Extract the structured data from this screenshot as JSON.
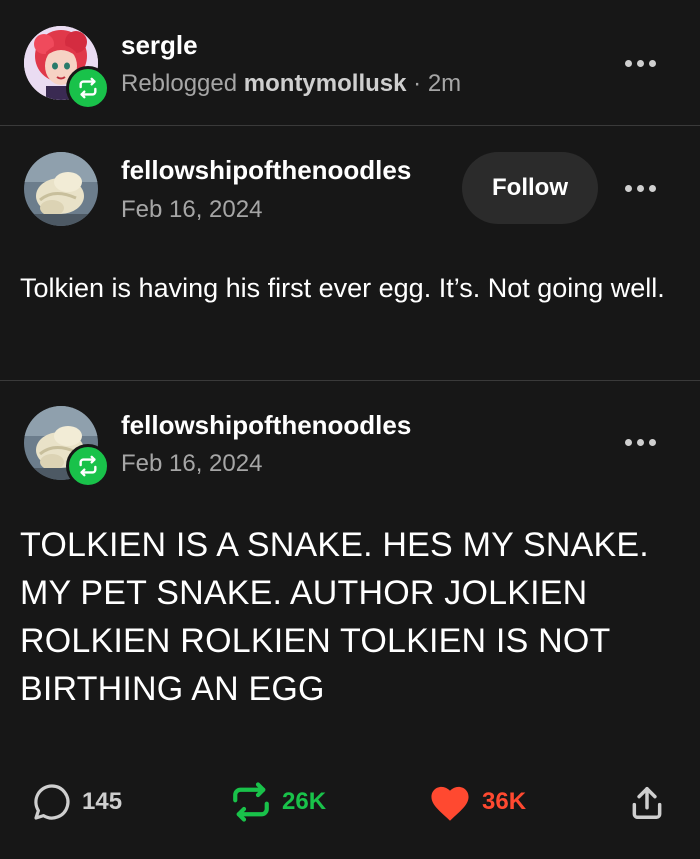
{
  "reblog_header": {
    "username": "sergle",
    "reblogged_prefix": "Reblogged",
    "reblogged_from": "montymollusk",
    "time": "· 2m",
    "avatar_icon": "anime-avatar-red-hair",
    "badge_icon": "reblog-icon",
    "more_icon": "more-options-icon"
  },
  "post1": {
    "username": "fellowshipofthenoodles",
    "date": "Feb 16, 2024",
    "follow_label": "Follow",
    "text": "Tolkien is having his first ever egg. It’s. Not going well.",
    "avatar_icon": "snake-avatar"
  },
  "post2": {
    "username": "fellowshipofthenoodles",
    "date": "Feb 16, 2024",
    "text": "TOLKIEN IS A SNAKE. HES MY SNAKE. MY PET SNAKE. AUTHOR JOLKIEN ROLKIEN ROLKIEN TOLKIEN IS NOT BIRTHING AN EGG",
    "avatar_icon": "snake-avatar",
    "badge_icon": "reblog-icon"
  },
  "actions": {
    "comments": "145",
    "reblogs": "26K",
    "likes": "36K",
    "colors": {
      "reblog": "#19c24a",
      "like": "#ff4930",
      "comment": "#cfcfcf"
    }
  }
}
